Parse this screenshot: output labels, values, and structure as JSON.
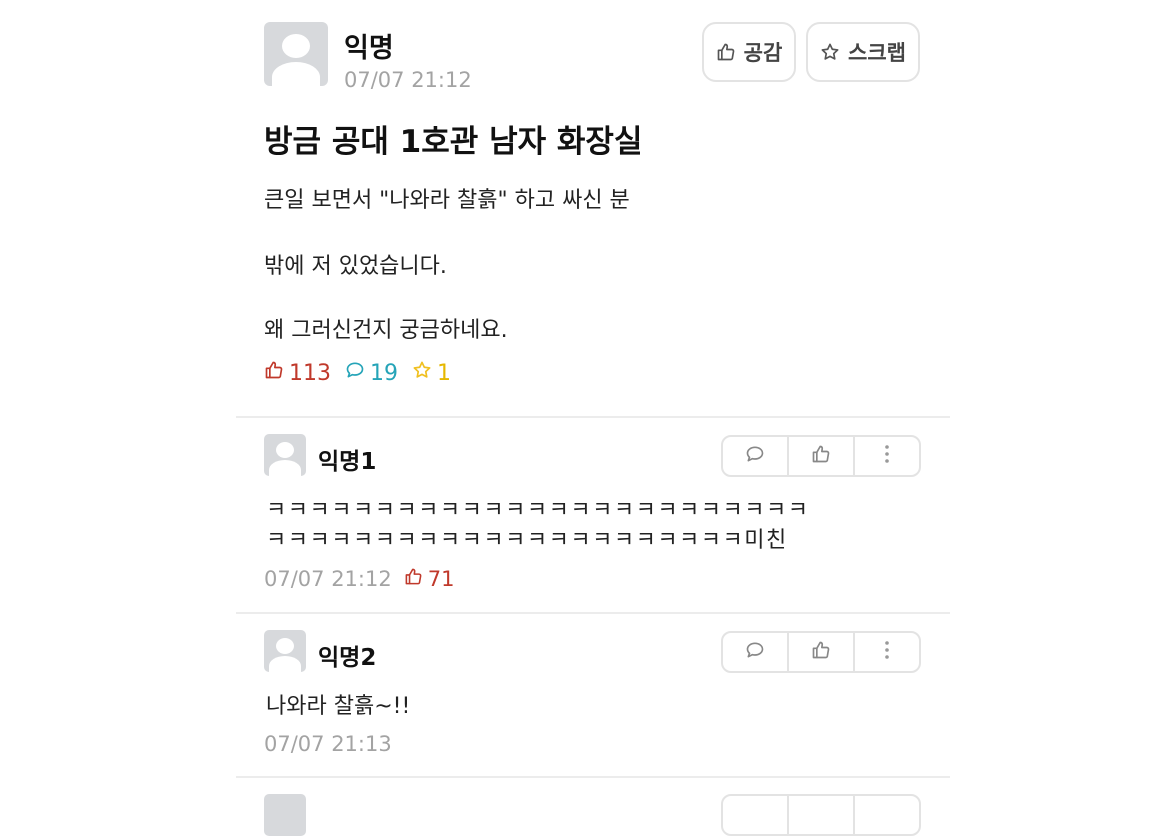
{
  "post": {
    "author": "익명",
    "time": "07/07 21:12",
    "title": "방금 공대 1호관 남자 화장실",
    "body": [
      "큰일 보면서 \"나와라 찰흙\" 하고 싸신 분",
      "밖에 저 있었습니다.",
      "왜 그러신건지 궁금하네요."
    ],
    "like_button": "공감",
    "scrap_button": "스크랩",
    "stats": {
      "likes": "113",
      "comments": "19",
      "scraps": "1"
    },
    "colors": {
      "like": "#c0392b",
      "comment": "#25a4b8",
      "scrap": "#f0c020"
    }
  },
  "comments": [
    {
      "author": "익명1",
      "lines": [
        "ㅋㅋㅋㅋㅋㅋㅋㅋㅋㅋㅋㅋㅋㅋㅋㅋㅋㅋㅋㅋㅋㅋㅋㅋㅋ",
        "ㅋㅋㅋㅋㅋㅋㅋㅋㅋㅋㅋㅋㅋㅋㅋㅋㅋㅋㅋㅋㅋㅋ미친"
      ],
      "time": "07/07 21:12",
      "likes": "71"
    },
    {
      "author": "익명2",
      "lines": [
        "나와라 찰흙~!!"
      ],
      "time": "07/07 21:13"
    }
  ],
  "comment_actions": {
    "reply_icon": "speech-bubble-icon",
    "like_icon": "thumbs-up-icon",
    "more_icon": "vertical-ellipsis-icon"
  }
}
